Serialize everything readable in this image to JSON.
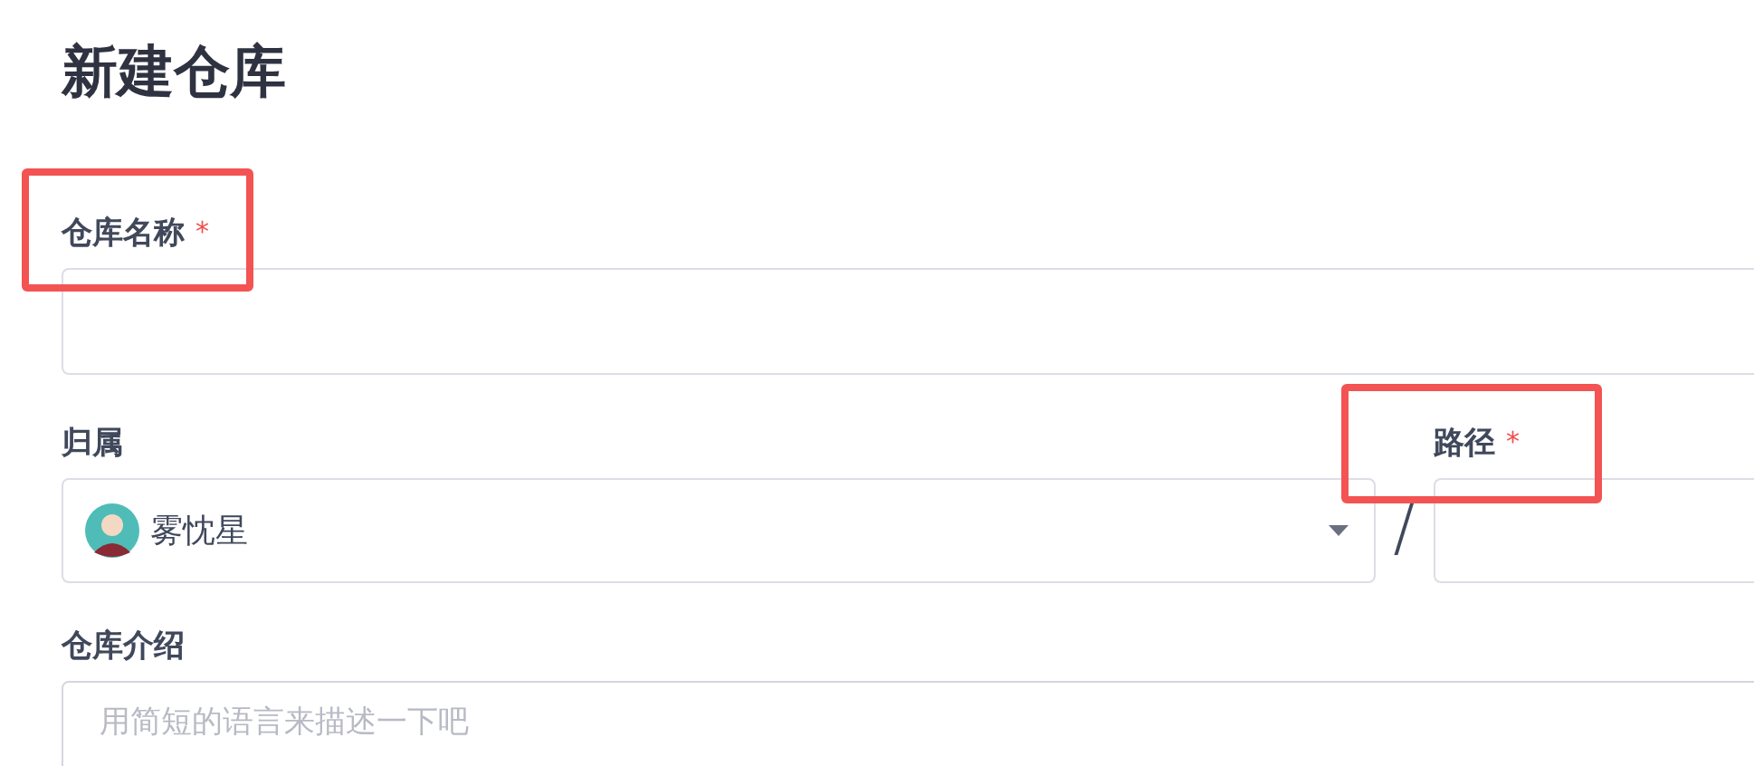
{
  "title": "新建仓库",
  "name_field": {
    "label": "仓库名称",
    "required_mark": "*",
    "highlighted": true
  },
  "owner_field": {
    "label": "归属",
    "value": "雾忱星",
    "highlighted": false
  },
  "separator": "/",
  "path_field": {
    "label": "路径",
    "required_mark": "*",
    "highlighted": true
  },
  "description_field": {
    "label": "仓库介绍",
    "placeholder": "用简短的语言来描述一下吧",
    "highlighted": false
  }
}
